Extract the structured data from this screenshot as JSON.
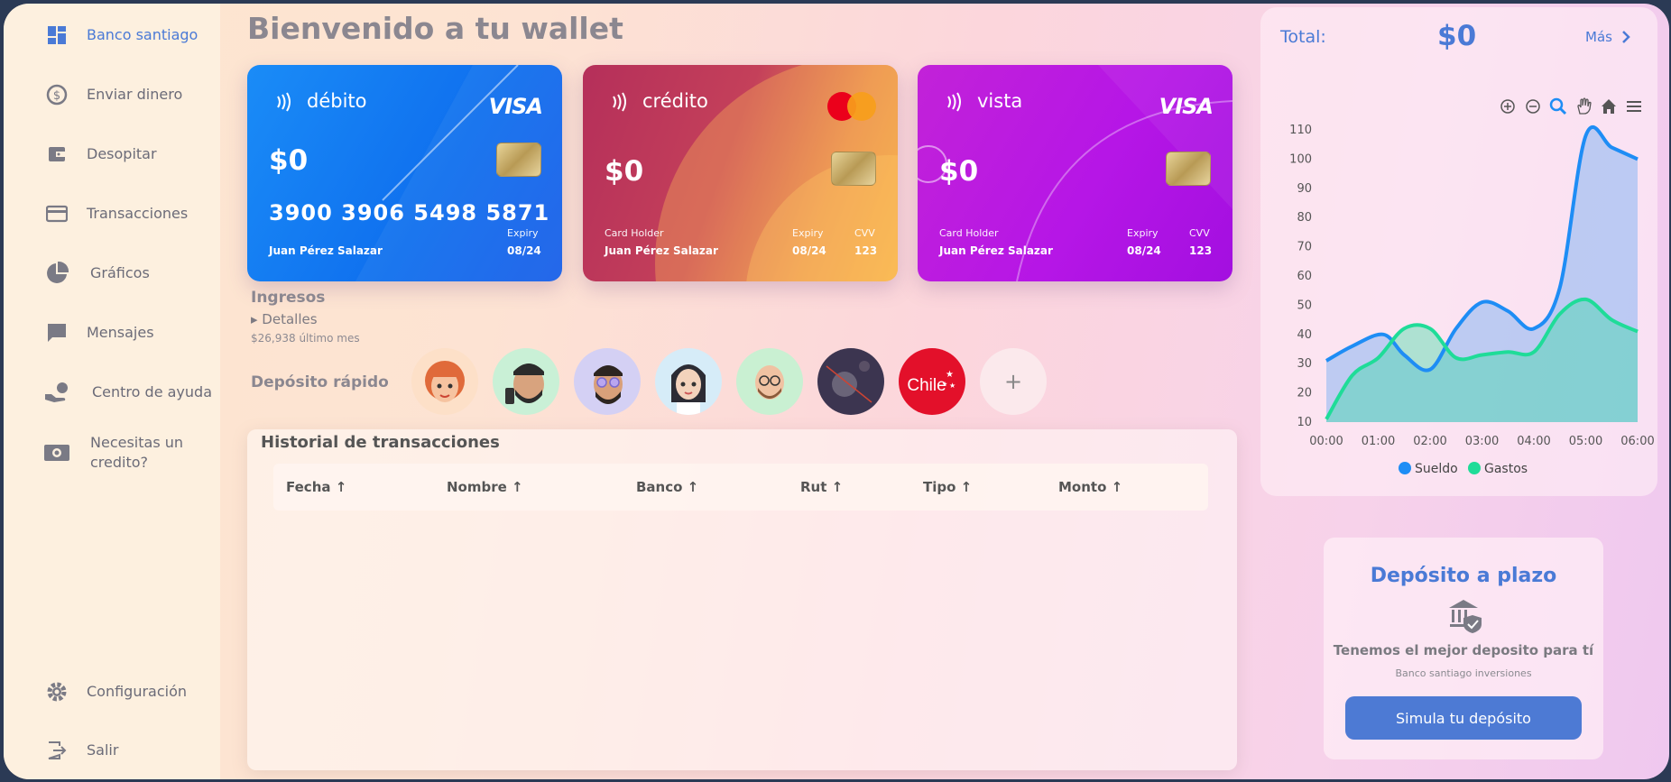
{
  "sidebar": {
    "items": [
      {
        "label": "Banco santiago",
        "icon": "dashboard-icon"
      },
      {
        "label": "Enviar dinero",
        "icon": "exchange-icon"
      },
      {
        "label": "Desopitar",
        "icon": "wallet-icon"
      },
      {
        "label": "Transacciones",
        "icon": "credit-card-icon"
      },
      {
        "label": "Gráficos",
        "icon": "pie-chart-icon"
      },
      {
        "label": "Mensajes",
        "icon": "message-icon"
      },
      {
        "label": "Centro de ayuda",
        "icon": "hand-coin-icon"
      },
      {
        "label": "Necesitas un credito?",
        "icon": "cash-icon"
      }
    ],
    "bottom": [
      {
        "label": "Configuración",
        "icon": "gear-icon"
      },
      {
        "label": "Salir",
        "icon": "logout-icon"
      }
    ]
  },
  "header": {
    "title": "Bienvenido a tu wallet"
  },
  "cards": [
    {
      "type": "débito",
      "brand": "VISA",
      "balance": "$0",
      "number": "3900 3906 5498 5871",
      "expiry_label": "Expiry",
      "expiry": "08/24",
      "holder": "Juan Pérez Salazar"
    },
    {
      "type": "crédito",
      "brand": "mastercard",
      "balance": "$0",
      "holder_label": "Card Holder",
      "holder": "Juan Pérez Salazar",
      "expiry_label": "Expiry",
      "expiry": "08/24",
      "cvv_label": "CVV",
      "cvv": "123"
    },
    {
      "type": "vista",
      "brand": "VISA",
      "balance": "$0",
      "holder_label": "Card Holder",
      "holder": "Juan Pérez Salazar",
      "expiry_label": "Expiry",
      "expiry": "08/24",
      "cvv_label": "CVV",
      "cvv": "123"
    }
  ],
  "ingresos": {
    "title": "Ingresos",
    "details": "▸ Detalles",
    "sub": "$26,938 último mes"
  },
  "quick_deposit": {
    "title": "Depósito rápido",
    "add": "+",
    "contacts": [
      "contact-1",
      "contact-2",
      "contact-3",
      "contact-4",
      "contact-5",
      "contact-6",
      "Chile"
    ]
  },
  "history": {
    "title": "Historial de transacciones",
    "columns": [
      "Fecha ↑",
      "Nombre ↑",
      "Banco ↑",
      "Rut ↑",
      "Tipo ↑",
      "Monto ↑"
    ]
  },
  "summary": {
    "total_label": "Total:",
    "total_value": "$0",
    "more": "Más"
  },
  "chart_data": {
    "type": "area",
    "x": [
      "00:00",
      "01:00",
      "02:00",
      "03:00",
      "04:00",
      "05:00",
      "06:00"
    ],
    "ylim": [
      10,
      110
    ],
    "yticks": [
      10,
      20,
      30,
      40,
      50,
      60,
      70,
      80,
      90,
      100,
      110
    ],
    "series": [
      {
        "name": "Sueldo",
        "color": "#1e8df5",
        "points": [
          [
            0,
            31
          ],
          [
            0.5,
            36
          ],
          [
            1.1,
            40
          ],
          [
            1.5,
            33
          ],
          [
            2,
            28
          ],
          [
            2.5,
            42
          ],
          [
            3,
            51
          ],
          [
            3.5,
            48
          ],
          [
            4,
            42
          ],
          [
            4.5,
            56
          ],
          [
            5,
            108
          ],
          [
            5.5,
            104
          ],
          [
            6,
            100
          ]
        ]
      },
      {
        "name": "Gastos",
        "color": "#1fdc98",
        "points": [
          [
            0,
            11
          ],
          [
            0.5,
            26
          ],
          [
            1,
            32
          ],
          [
            1.5,
            42
          ],
          [
            2,
            42
          ],
          [
            2.5,
            32
          ],
          [
            3,
            33
          ],
          [
            3.5,
            34
          ],
          [
            4,
            34
          ],
          [
            4.5,
            47
          ],
          [
            5,
            52
          ],
          [
            5.5,
            45
          ],
          [
            6,
            41
          ]
        ]
      }
    ],
    "legend": "bottom"
  },
  "deposit": {
    "title": "Depósito a plazo",
    "text": "Tenemos el mejor deposito para tí",
    "sub": "Banco santiago inversiones",
    "button": "Simula tu depósito"
  }
}
